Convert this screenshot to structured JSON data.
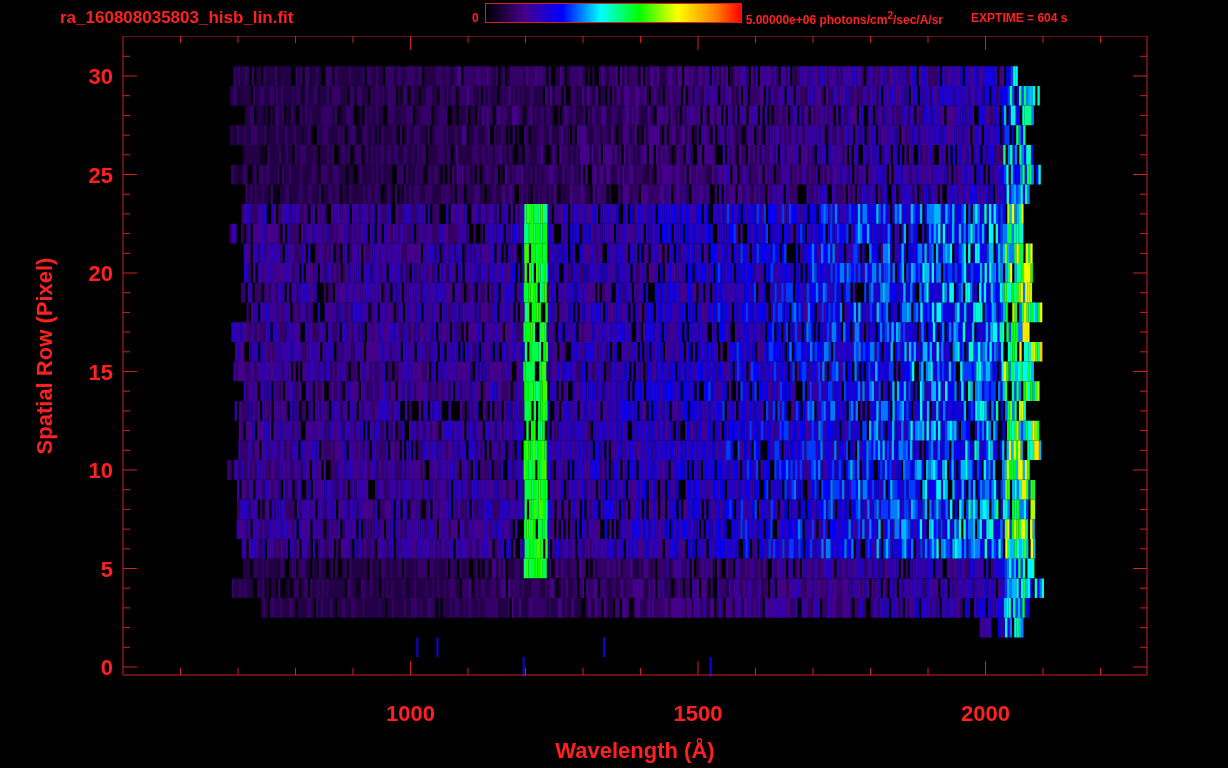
{
  "header": {
    "title": "ra_160808035803_hisb_lin.fit",
    "colorbar": {
      "min_label": "0",
      "max_label": "5.00000e+06 photons/cm$^{2}$/sec/A/sr"
    },
    "exposure": "EXPTIME = 604 s"
  },
  "plot": {
    "x_axis": {
      "label": "Wavelength (Å)",
      "ticks": [
        "1000",
        "1500",
        "2000"
      ]
    },
    "y_axis": {
      "label": "Spatial Row (Pixel)",
      "ticks": [
        "30",
        "25",
        "20",
        "15",
        "10",
        "5",
        "0"
      ]
    }
  }
}
